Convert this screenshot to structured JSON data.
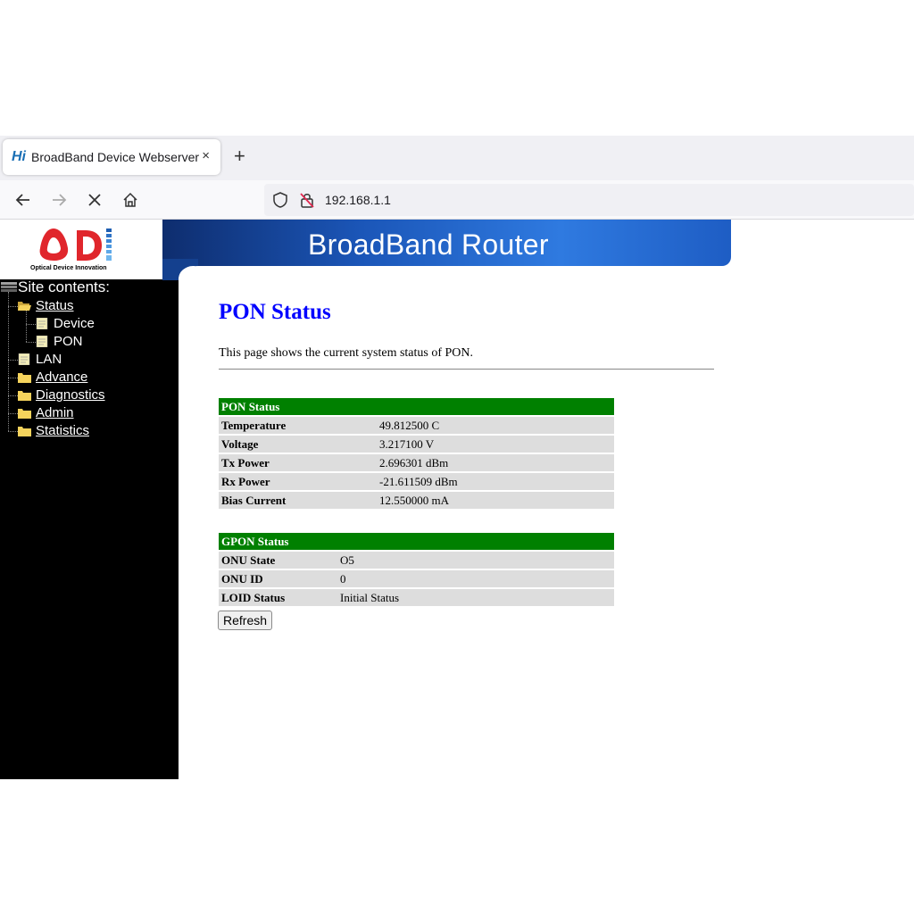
{
  "browser": {
    "tab_favicon": "Hi",
    "tab_title": "BroadBand Device Webserver",
    "tab_close": "×",
    "new_tab": "+",
    "url": "192.168.1.1"
  },
  "logo": {
    "caption": "Optical Device Innovation"
  },
  "banner": {
    "title": "BroadBand Router"
  },
  "sidebar": {
    "root_label": "Site contents:",
    "items": [
      {
        "label": "Status",
        "icon": "open-folder-icon"
      },
      {
        "label": "Device",
        "icon": "document-icon"
      },
      {
        "label": "PON",
        "icon": "document-icon"
      },
      {
        "label": "LAN",
        "icon": "document-icon"
      },
      {
        "label": "Advance",
        "icon": "folder-icon"
      },
      {
        "label": "Diagnostics",
        "icon": "folder-icon"
      },
      {
        "label": "Admin",
        "icon": "folder-icon"
      },
      {
        "label": "Statistics",
        "icon": "folder-icon"
      }
    ]
  },
  "main": {
    "title": "PON Status",
    "description": "This page shows the current system status of PON.",
    "pon_table": {
      "header": "PON Status",
      "rows": [
        {
          "label": "Temperature",
          "value": "49.812500 C"
        },
        {
          "label": "Voltage",
          "value": "3.217100 V"
        },
        {
          "label": "Tx Power",
          "value": "2.696301 dBm"
        },
        {
          "label": "Rx Power",
          "value": "-21.611509 dBm"
        },
        {
          "label": "Bias Current",
          "value": "12.550000 mA"
        }
      ]
    },
    "gpon_table": {
      "header": "GPON Status",
      "rows": [
        {
          "label": "ONU State",
          "value": "O5"
        },
        {
          "label": "ONU ID",
          "value": "0"
        },
        {
          "label": "LOID Status",
          "value": "Initial Status"
        }
      ]
    },
    "refresh_label": "Refresh"
  },
  "colors": {
    "table_header": "#008000",
    "title": "#0000ff",
    "banner": "#1b56b8",
    "sidebar_bg": "#000000"
  }
}
